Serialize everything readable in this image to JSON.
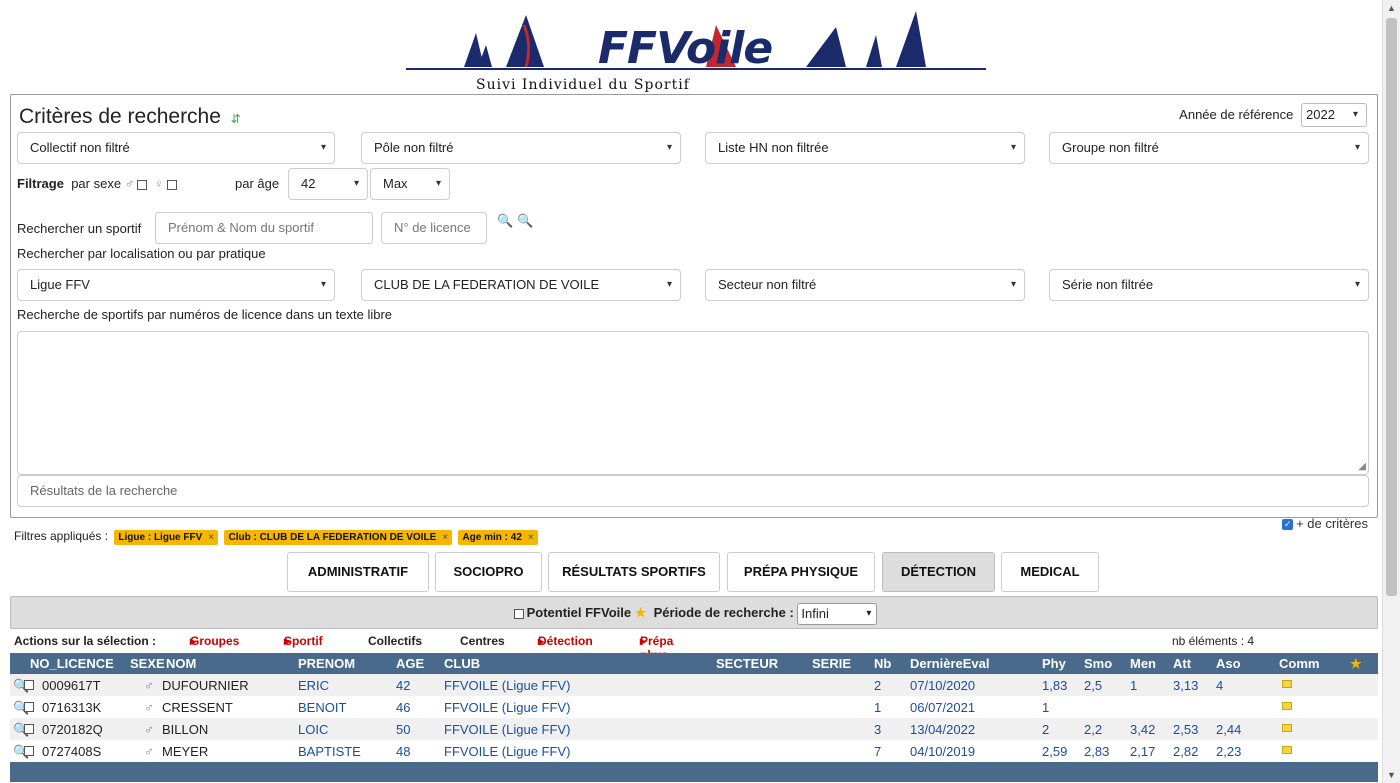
{
  "header": {
    "logo_text": "FFVoile",
    "subtitle": "Suivi Individuel du Sportif"
  },
  "criteria": {
    "title": "Critères de recherche",
    "annee_label": "Année de référence",
    "annee_value": "2022",
    "selects_row1": [
      "Collectif non filtré",
      "Pôle non filtré",
      "Liste HN non filtrée",
      "Groupe non filtré"
    ],
    "filtrage_label": "Filtrage",
    "par_sexe_label": "par sexe",
    "par_age_label": "par âge",
    "age_value": "42",
    "age_max": "Max",
    "rechercher_sportif_label": "Rechercher un sportif",
    "nom_placeholder": "Prénom & Nom du sportif",
    "licence_placeholder": "N° de licence",
    "localisation_label": "Rechercher par localisation ou par pratique",
    "selects_row2": [
      "Ligue FFV",
      "CLUB DE LA FEDERATION DE VOILE",
      "Secteur non filtré",
      "Série non filtrée"
    ],
    "texte_libre_label": "Recherche de sportifs par numéros de licence dans un texte libre",
    "results_placeholder": "Résultats de la recherche",
    "plus_criteres": "+ de critères"
  },
  "filters": {
    "label": "Filtres appliqués :",
    "tags": [
      "Ligue : Ligue FFV",
      "Club : CLUB DE LA FEDERATION DE VOILE",
      "Age min : 42"
    ]
  },
  "tabs": [
    "ADMINISTRATIF",
    "SOCIOPRO",
    "RÉSULTATS SPORTIFS",
    "PRÉPA PHYSIQUE",
    "DÉTECTION",
    "MEDICAL"
  ],
  "detection_bar": {
    "potentiel_label": "Potentiel FFVoile",
    "periode_label": "Période de recherche :",
    "periode_value": "Infini"
  },
  "actions": {
    "label": "Actions sur la sélection :",
    "groupes": "Groupes",
    "sportif": "Sportif",
    "collectifs": "Collectifs",
    "centres": "Centres",
    "detection": "Détection",
    "prepa": "Prépa phys",
    "nb_elements": "nb éléments : 4"
  },
  "table": {
    "headers": {
      "licence": "NO_LICENCE",
      "sexe": "SEXE",
      "nom": "NOM",
      "prenom": "PRENOM",
      "age": "AGE",
      "club": "CLUB",
      "secteur": "SECTEUR",
      "serie": "SERIE",
      "nb": "Nb",
      "derniere": "DernièreEval",
      "phy": "Phy",
      "smo": "Smo",
      "men": "Men",
      "att": "Att",
      "aso": "Aso",
      "comm": "Comm"
    },
    "rows": [
      {
        "licence": "0009617T",
        "nom": "DUFOURNIER",
        "prenom": "ERIC",
        "age": "42",
        "club": "FFVOILE (Ligue FFV)",
        "nb": "2",
        "date": "07/10/2020",
        "phy": "1,83",
        "smo": "2,5",
        "men": "1",
        "att": "3,13",
        "aso": "4"
      },
      {
        "licence": "0716313K",
        "nom": "CRESSENT",
        "prenom": "BENOIT",
        "age": "46",
        "club": "FFVOILE (Ligue FFV)",
        "nb": "1",
        "date": "06/07/2021",
        "phy": "1",
        "smo": "",
        "men": "",
        "att": "",
        "aso": ""
      },
      {
        "licence": "0720182Q",
        "nom": "BILLON",
        "prenom": "LOIC",
        "age": "50",
        "club": "FFVOILE (Ligue FFV)",
        "nb": "3",
        "date": "13/04/2022",
        "phy": "2",
        "smo": "2,2",
        "men": "3,42",
        "att": "2,53",
        "aso": "2,44"
      },
      {
        "licence": "0727408S",
        "nom": "MEYER",
        "prenom": "BAPTISTE",
        "age": "48",
        "club": "FFVOILE (Ligue FFV)",
        "nb": "7",
        "date": "04/10/2019",
        "phy": "2,59",
        "smo": "2,83",
        "men": "2,17",
        "att": "2,82",
        "aso": "2,23"
      }
    ]
  },
  "colors": {
    "header_blue": "#4a6a8c",
    "tag_yellow": "#f5b600",
    "brand_navy": "#1b2a6b"
  }
}
